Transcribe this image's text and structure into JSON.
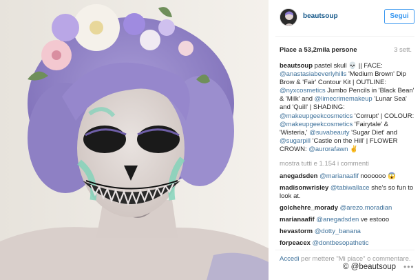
{
  "post": {
    "image_alt": "Pastel skull makeup with lavender hair and flower crown"
  },
  "header": {
    "username": "beautsoup",
    "follow_label": "Segui"
  },
  "meta": {
    "likes": "Piace a 53,2mila persone",
    "time": "3 sett."
  },
  "caption": {
    "username": "beautsoup",
    "segments": [
      {
        "t": " pastel skull 💀 || FACE: ",
        "m": false
      },
      {
        "t": "@anastasiabeverlyhills",
        "m": true
      },
      {
        "t": " 'Medium Brown' Dip Brow & 'Fair' Contour Kit | OUTLINE: ",
        "m": false
      },
      {
        "t": "@nyxcosmetics",
        "m": true
      },
      {
        "t": " Jumbo Pencils in 'Black Bean' & 'Milk' and ",
        "m": false
      },
      {
        "t": "@limecrimemakeup",
        "m": true
      },
      {
        "t": " 'Lunar Sea' and 'Quill' | SHADING: ",
        "m": false
      },
      {
        "t": "@makeupgeekcosmetics",
        "m": true
      },
      {
        "t": " 'Corrupt' | COLOUR: ",
        "m": false
      },
      {
        "t": "@makeupgeekcosmetics",
        "m": true
      },
      {
        "t": " 'Fairytale' & 'Wisteria,' ",
        "m": false
      },
      {
        "t": "@suvabeauty",
        "m": true
      },
      {
        "t": " 'Sugar Diet' and ",
        "m": false
      },
      {
        "t": "@sugarpill",
        "m": true
      },
      {
        "t": " 'Castle on the Hill' | FLOWER CROWN: ",
        "m": false
      },
      {
        "t": "@aurorafawn",
        "m": true
      },
      {
        "t": " ✌",
        "m": false
      }
    ]
  },
  "more_comments": "mostra tutti e 1.154 i commenti",
  "comments": [
    {
      "user": "anegadsden",
      "mention": "@marianaafif",
      "text": " noooooo 😱"
    },
    {
      "user": "madisonwrisley",
      "mention": "@tabiwallace",
      "text": " she's so fun to look at."
    },
    {
      "user": "golchehre_morady",
      "mention": "@arezo.moradian",
      "text": ""
    },
    {
      "user": "marianaafif",
      "mention": "@anegadsden",
      "text": " ve estooo"
    },
    {
      "user": "hevastorm",
      "mention": "@dotty_banana",
      "text": ""
    },
    {
      "user": "forpeacex",
      "mention": "@dontbesopathetic",
      "text": ""
    }
  ],
  "footer": {
    "login_link": "Accedi",
    "login_text": " per mettere \"Mi piace\" o commentare."
  },
  "watermark": "© @beautsoup",
  "more_icon": "•••",
  "colors": {
    "mention": "#3f729b",
    "follow": "#3897f0",
    "muted": "#999999"
  }
}
